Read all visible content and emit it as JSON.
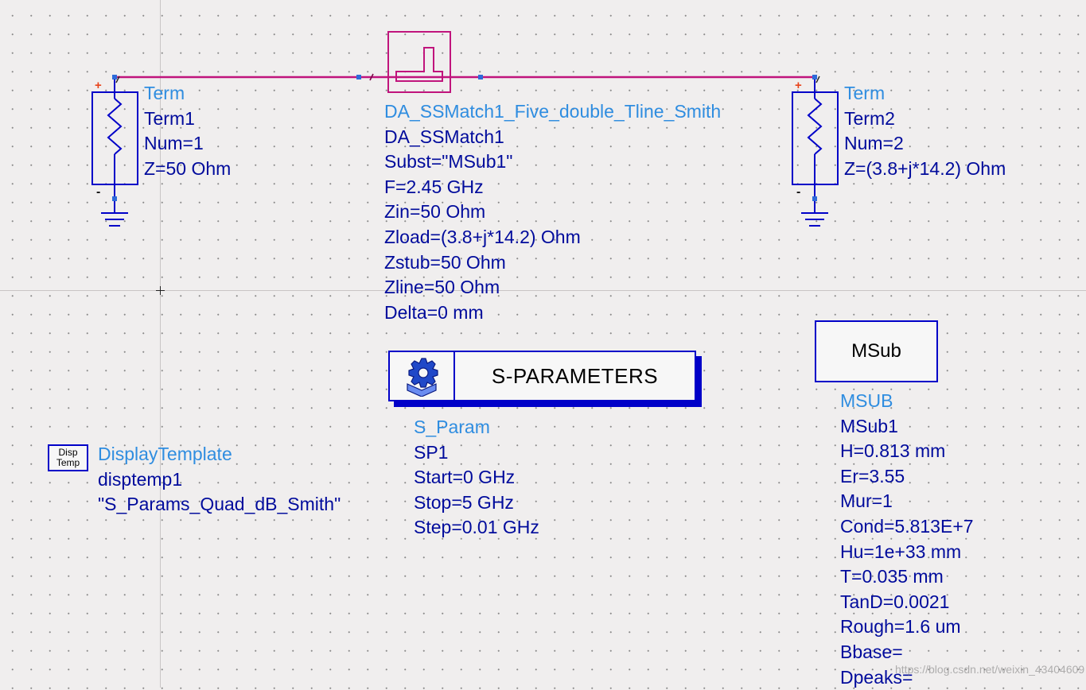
{
  "term1": {
    "header": "Term",
    "name": "Term1",
    "num": "Num=1",
    "z": "Z=50 Ohm",
    "plus": "+",
    "minus": "-"
  },
  "term2": {
    "header": "Term",
    "name": "Term2",
    "num": "Num=2",
    "z": "Z=(3.8+j*14.2) Ohm",
    "plus": "+",
    "minus": "-"
  },
  "match": {
    "header": "DA_SSMatch1_Five_double_Tline_Smith",
    "name": "DA_SSMatch1",
    "params": [
      "Subst=\"MSub1\"",
      "F=2.45 GHz",
      "Zin=50 Ohm",
      "Zload=(3.8+j*14.2) Ohm",
      "Zstub=50 Ohm",
      "Zline=50 Ohm",
      "Delta=0 mm"
    ]
  },
  "sparam": {
    "box_title": "S-PARAMETERS",
    "header": "S_Param",
    "name": "SP1",
    "params": [
      "Start=0 GHz",
      "Stop=5 GHz",
      "Step=0.01 GHz"
    ]
  },
  "msub": {
    "box_title": "MSub",
    "header": "MSUB",
    "name": "MSub1",
    "params": [
      "H=0.813 mm",
      "Er=3.55",
      "Mur=1",
      "Cond=5.813E+7",
      "Hu=1e+33 mm",
      "T=0.035 mm",
      "TanD=0.0021",
      "Rough=1.6 um",
      "Bbase=",
      "Dpeaks="
    ]
  },
  "display_template": {
    "icon_line1": "Disp",
    "icon_line2": "Temp",
    "header": "DisplayTemplate",
    "name": "disptemp1",
    "value": "\"S_Params_Quad_dB_Smith\""
  },
  "watermark": "https://blog.csdn.net/weixin_43404609",
  "colors": {
    "background": "#f0eeee",
    "wire": "#c0147c",
    "component": "#0000c8",
    "label_header": "#2f8de0",
    "label_text": "#000b9c",
    "pin": "#2e6bd9",
    "plus": "#e8431b"
  }
}
